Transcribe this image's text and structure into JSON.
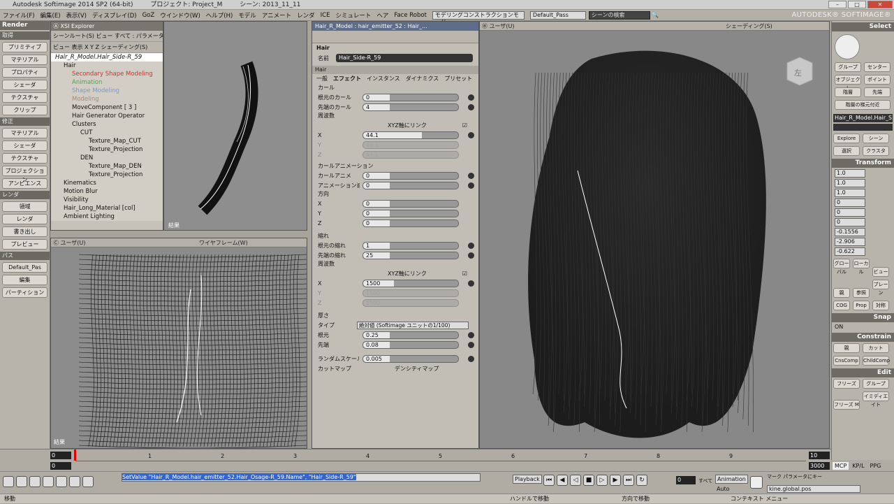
{
  "titlebar": {
    "app": "Autodesk Softimage 2014 SP2 (64-bit)",
    "project": "プロジェクト: Project_M",
    "scene": "シーン: 2013_11_11"
  },
  "menu": [
    "ファイル(F)",
    "編集(E)",
    "表示(V)",
    "ディスプレイ(D)",
    "GoZ",
    "ウインドウ(W)",
    "ヘルプ(H)",
    "モデル",
    "アニメート",
    "レンダ",
    "ICE",
    "シミュレート",
    "ヘア",
    "Face Robot"
  ],
  "mode_dropdown": "モデリングコンストラクションモード",
  "pass_dropdown": "Default_Pass",
  "search_placeholder": "シーンの検索",
  "brand": "AUTODESK® SOFTIMAGE®",
  "left": {
    "module": "Render",
    "sections": [
      {
        "title": "取得",
        "items": [
          "プリミティブ",
          "マテリアル",
          "プロパティ",
          "シェーダ",
          "テクスチャ",
          "クリップ"
        ]
      },
      {
        "title": "修正",
        "items": [
          "マテリアル",
          "シェーダ",
          "テクスチャ",
          "プロジェクション",
          "アンビエンス"
        ]
      },
      {
        "title": "レンダ",
        "items": [
          "領域",
          "レンダ",
          "書き出し",
          "プレビュー"
        ]
      },
      {
        "title": "パス",
        "items": [
          "Default_Pas",
          "編集",
          "パーティション"
        ]
      }
    ]
  },
  "explorer": {
    "title": "XSI Explorer",
    "toolbar1": "シーンルート(S)  ビュー  すべて : パラメータ以外(E)  ビュー",
    "toolbar2": "ビュー  表示  X Y Z  シェーディング(S)",
    "tree": [
      "Hair_R_Model.Hair_Side-R_59",
      "Hair",
      "Secondary Shape Modeling",
      "Animation",
      "Shape Modeling",
      "Modeling",
      "MoveComponent [ 3 ]",
      "Hair Generator Operator",
      "Clusters",
      "CUT",
      "Texture_Map_CUT",
      "Texture_Projection",
      "DEN",
      "Texture_Map_DEN",
      "Texture_Projection",
      "Kinematics",
      "Motion Blur",
      "Visibility",
      "Hair_Long_Material [col]",
      "Ambient Lighting"
    ]
  },
  "vp1": {
    "label": "結果"
  },
  "vp2": {
    "header": "ユーザ(U)",
    "mode": "ワイヤフレーム(W)",
    "label": "結果"
  },
  "ppg": {
    "title": "Hair_R_Model : hair_emitter_52 : Hair_...",
    "tab": "Hair",
    "name_label": "名前",
    "name_value": "Hair_Side-R_59",
    "section": "Hair",
    "subtabs": [
      "一般",
      "エフェクト",
      "インスタンス",
      "ダイナミクス",
      "プリセット"
    ],
    "curl": {
      "title": "カール",
      "root": {
        "label": "根元のカール",
        "value": "0",
        "frac": 0.0
      },
      "tip": {
        "label": "先端のカール",
        "value": "4",
        "frac": 0.0
      }
    },
    "freq1": {
      "title": "周波数",
      "link": "XYZ軸にリンク",
      "x": "44.1",
      "y": "44.1",
      "z": "44.1"
    },
    "curlanim": {
      "title": "カールアニメーション",
      "anim": "0",
      "speed": "0",
      "dir": "方向",
      "x": "0",
      "y": "0",
      "z": "0"
    },
    "kink": {
      "title": "縮れ",
      "root": "1",
      "tip": "25"
    },
    "freq2": {
      "title": "周波数",
      "link": "XYZ軸にリンク",
      "x": "1500",
      "y": "1500",
      "z": "1500"
    },
    "thick": {
      "title": "厚さ",
      "type_label": "タイプ",
      "type_value": "絶対値 (Softimage ユニットの1/100)",
      "root_label": "根元",
      "root": "0.25",
      "tip_label": "先端",
      "tip": "0.08"
    },
    "random": {
      "label": "ランダムスケール",
      "value": "0.005"
    },
    "cutmap": "カットマップ",
    "densitymap": "デンシティマップ"
  },
  "vp3": {
    "header": "ユーザ(U)",
    "shading": "シェーディング(S)",
    "cube_label": "左"
  },
  "right": {
    "select": "Select",
    "buttons": [
      "グループ",
      "センター",
      "オブジェクト",
      "ポイント",
      "階層",
      "先端",
      "階層の梯元付近"
    ],
    "object_name": "Hair_R_Model.Hair_S",
    "explore": [
      "Explore",
      "シーン",
      "選択",
      "クラスタ"
    ],
    "transform": "Transform",
    "scl": [
      "1.0",
      "1.0",
      "1.0"
    ],
    "rot": [
      "0",
      "0",
      "0"
    ],
    "pos": [
      "-0.1556",
      "-2.906",
      "-0.622"
    ],
    "coords": [
      "グローバル",
      "ローカル",
      "ビュー",
      "親",
      "参照",
      "プレーン"
    ],
    "cog": [
      "COG",
      "Prop",
      "対称"
    ],
    "snap": "Snap",
    "snap_on": "ON",
    "constrain": "Constrain",
    "con": [
      "親",
      "カット",
      "CnsComp",
      "ChildComp"
    ],
    "edit": "Edit",
    "ed": [
      "フリーズ",
      "グループ",
      "フリーズ M",
      "イミディエイト"
    ]
  },
  "timeline": {
    "start": "0",
    "start2": "0",
    "end": "10",
    "end2": "3000",
    "ticks": [
      "1",
      "2",
      "3",
      "4",
      "5",
      "6",
      "7",
      "8",
      "9"
    ],
    "tabs": [
      "MCP",
      "KP/L",
      "PPG"
    ]
  },
  "cmd": {
    "script": "SetValue \"Hair_R_Model.hair_emitter_52.Hair_Osage-R_59.Name\", \"Hair_Side-R_59\"",
    "playback": "Playback",
    "frame": "0",
    "all": "すべて",
    "animation": "Animation",
    "auto": "Auto",
    "marker": "マーク パラメータにキー",
    "kine": "kine.global.pos"
  },
  "status": {
    "left": "移動",
    "mid1": "ハンドルで移動",
    "mid2": "方向で移動",
    "mid3": "コンテキスト メニュー"
  }
}
